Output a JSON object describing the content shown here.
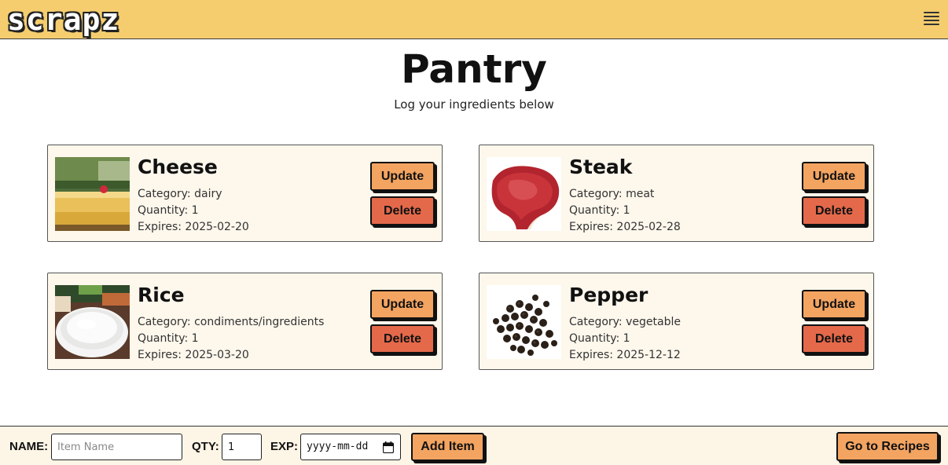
{
  "header": {
    "logo_text": "scrapz",
    "menu_icon": "hamburger-menu-icon"
  },
  "page": {
    "title": "Pantry",
    "subtitle": "Log your ingredients below"
  },
  "items": [
    {
      "name": "Cheese",
      "category": "Category: dairy",
      "quantity": "Quantity: 1",
      "expires": "Expires: 2025-02-20",
      "image": "cheese-image",
      "update_label": "Update",
      "delete_label": "Delete"
    },
    {
      "name": "Steak",
      "category": "Category: meat",
      "quantity": "Quantity: 1",
      "expires": "Expires: 2025-02-28",
      "image": "steak-image",
      "update_label": "Update",
      "delete_label": "Delete"
    },
    {
      "name": "Rice",
      "category": "Category: condiments/ingredients",
      "quantity": "Quantity: 1",
      "expires": "Expires: 2025-03-20",
      "image": "rice-image",
      "update_label": "Update",
      "delete_label": "Delete"
    },
    {
      "name": "Pepper",
      "category": "Category: vegetable",
      "quantity": "Quantity: 1",
      "expires": "Expires: 2025-12-12",
      "image": "pepper-image",
      "update_label": "Update",
      "delete_label": "Delete"
    }
  ],
  "form": {
    "name_label": "NAME:",
    "name_placeholder": "Item Name",
    "name_value": "",
    "qty_label": "QTY:",
    "qty_value": "1",
    "exp_label": "EXP:",
    "exp_placeholder": "yyyy-mm-dd",
    "exp_icon": "calendar-icon",
    "add_label": "Add Item",
    "recipes_label": "Go to Recipes"
  },
  "colors": {
    "header_bg": "#f5cd6e",
    "card_bg": "#fdf7ec",
    "update_button": "#f3a461",
    "delete_button": "#e4694a",
    "footer_bg": "#fdf5e6"
  }
}
